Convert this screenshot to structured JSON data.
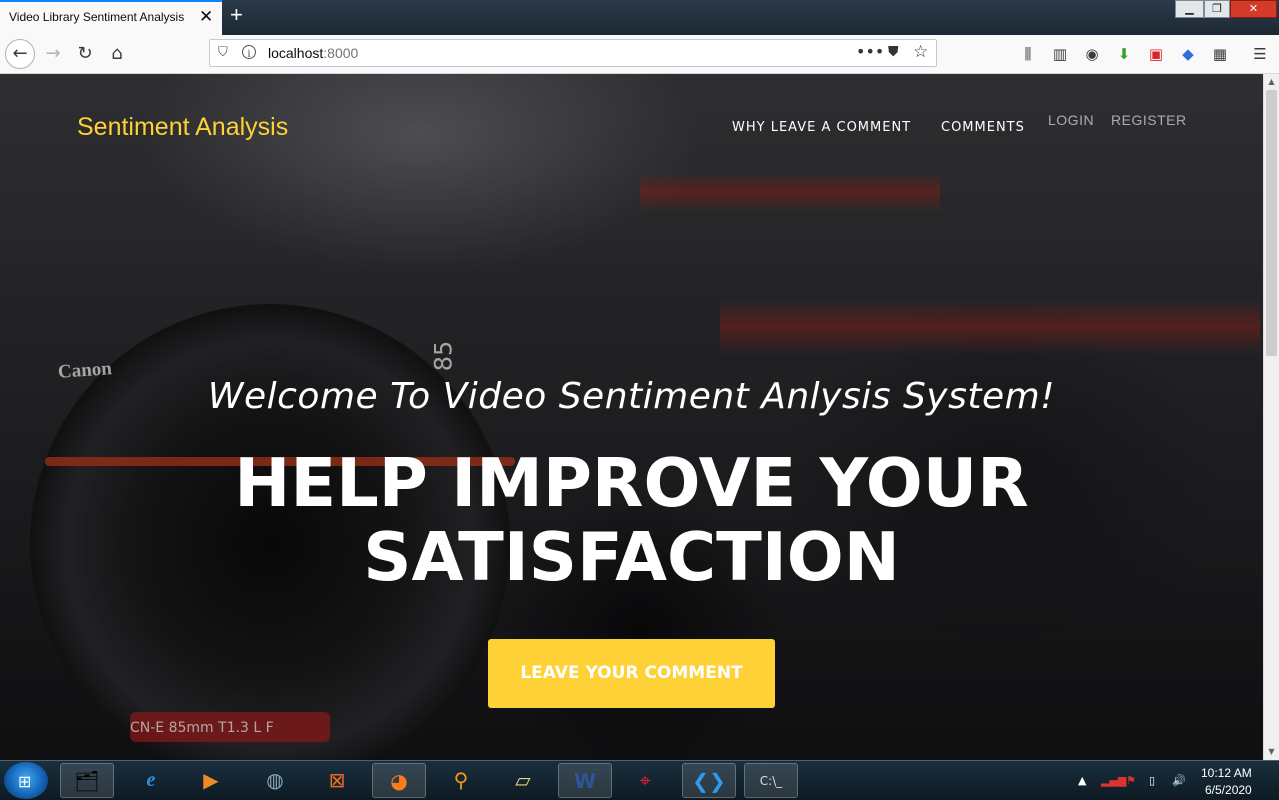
{
  "browser": {
    "tab_title": "Video Library Sentiment Analysis",
    "tab_close": "✕",
    "new_tab": "+",
    "url_host": "localhost",
    "url_port": ":8000"
  },
  "site": {
    "brand": "Sentiment Analysis",
    "nav": {
      "why": "Why Leave A Comment",
      "comments": "Comments",
      "login": "LOGIN",
      "register": "REGISTER"
    },
    "hero": {
      "lead": "Welcome To Video Sentiment Anlysis System!",
      "heading_line1": "HELP IMPROVE YOUR",
      "heading_line2": "SATISFACTION",
      "cta": "Leave Your Comment"
    },
    "background_marks": {
      "canon": "Canon",
      "focal": "85",
      "lens_spec": "CN-E 85mm  T1.3 L F"
    }
  },
  "taskbar": {
    "time": "10:12 AM",
    "date": "6/5/2020"
  },
  "colors": {
    "accent": "#fed136",
    "tab_highlight": "#0a84ff"
  }
}
